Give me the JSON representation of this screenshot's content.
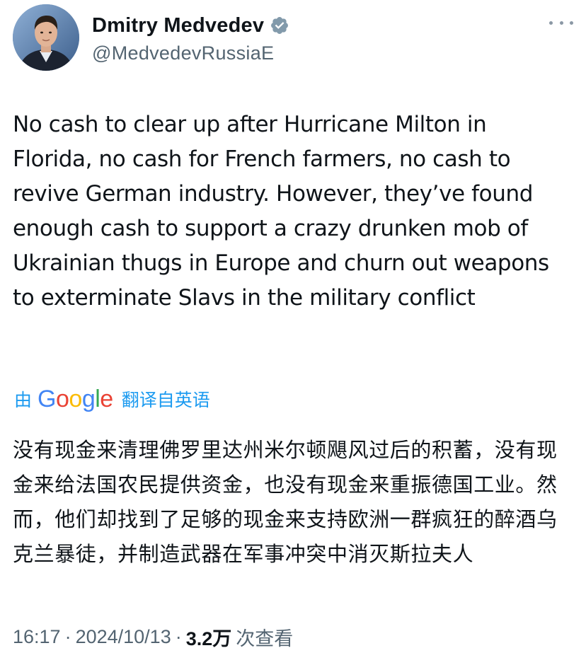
{
  "author": {
    "display_name": "Dmitry Medvedev",
    "handle": "@MedvedevRussiaE",
    "verified": true
  },
  "icons": {
    "more": "more-horizontal-icon",
    "verified": "verified-badge-icon",
    "avatar": "profile-photo"
  },
  "colors": {
    "link_blue": "#1d9bf0",
    "secondary_text": "#536471",
    "primary_text": "#0f1419",
    "verified_badge": "#829aab"
  },
  "tweet": {
    "text": "No cash to clear up after Hurricane Milton in Florida, no cash for French farmers, no cash to revive German industry. However, they’ve found enough cash to support a crazy drunken mob of Ukrainian thugs in Europe and churn out weapons to exterminate Slavs in the military conflict"
  },
  "translation": {
    "prefix": "由",
    "provider": "Google",
    "suffix": "翻译自英语",
    "text": "没有现金来清理佛罗里达州米尔顿飓风过后的积蓄，没有现金来给法国农民提供资金，也没有现金来重振德国工业。然而，他们却找到了足够的现金来支持欧洲一群疯狂的醉酒乌克兰暴徒，并制造武器在军事冲突中消灭斯拉夫人"
  },
  "meta": {
    "time": "16:17",
    "separator": "·",
    "date": "2024/10/13",
    "views_count": "3.2万",
    "views_label": "次查看"
  }
}
